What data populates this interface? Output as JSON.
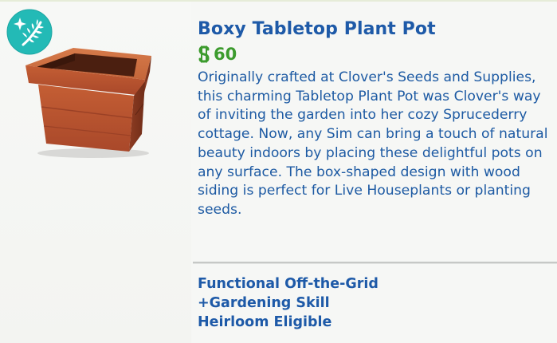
{
  "item": {
    "name": "Boxy Tabletop Plant Pot",
    "price": "60",
    "currency_icon": "simoleon-icon",
    "badge_icon": "sparkle-leaf-icon",
    "description": "Originally crafted at Clover's Seeds and Supplies, this charming Tabletop Plant Pot was Clover's way of inviting the garden into her cozy Sprucederry cottage. Now, any Sim can bring a touch of natural beauty indoors by placing these delightful pots on any surface. The box-shaped design with wood siding is perfect for Live Houseplants or planting seeds."
  },
  "tags": [
    "Functional Off-the-Grid",
    "+Gardening Skill",
    "Heirloom Eligible"
  ],
  "colors": {
    "title": "#1e5aa8",
    "price": "#3c9b2d",
    "badge": "#22b9b5",
    "pot": "#b5532c"
  }
}
